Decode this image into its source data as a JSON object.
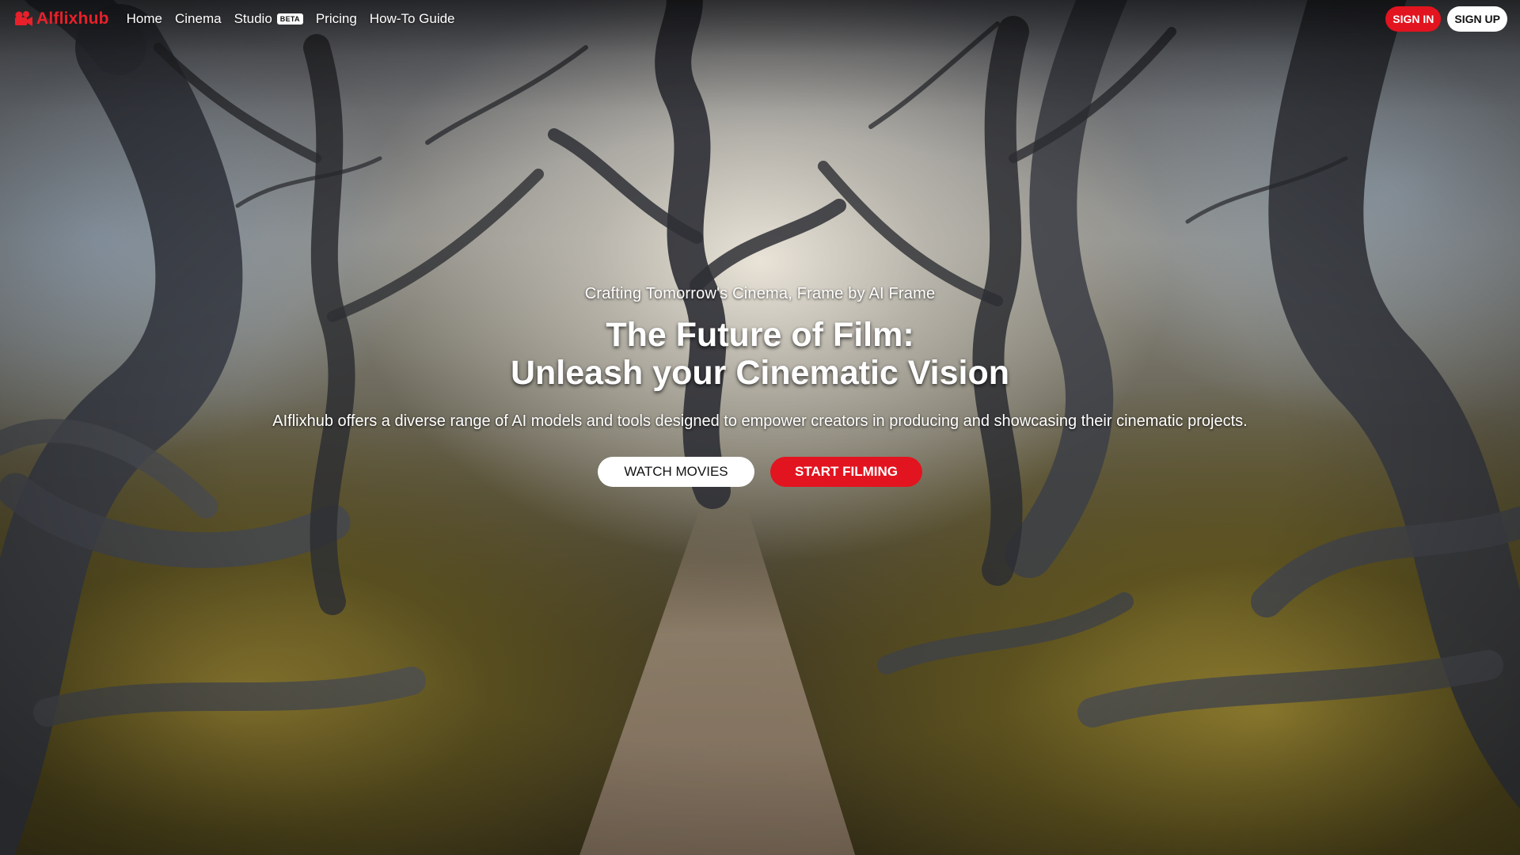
{
  "brand": {
    "name": "Alflixhub",
    "logo_icon": "film-logo-icon",
    "color": "#e8202a"
  },
  "nav": {
    "links": [
      {
        "label": "Home"
      },
      {
        "label": "Cinema"
      },
      {
        "label": "Studio",
        "badge": "BETA"
      },
      {
        "label": "Pricing"
      },
      {
        "label": "How-To Guide"
      }
    ],
    "sign_in": "SIGN IN",
    "sign_up": "SIGN UP"
  },
  "hero": {
    "tagline": "Crafting Tomorrow's Cinema, Frame by AI Frame",
    "title_line1": "The Future of Film:",
    "title_line2": "Unleash your Cinematic Vision",
    "description": "AIflixhub offers a diverse range of AI models and tools designed to empower creators in producing and showcasing their cinematic projects.",
    "watch_button": "WATCH MOVIES",
    "film_button": "START FILMING"
  },
  "colors": {
    "accent": "#e2141f",
    "button_light": "#ffffff"
  }
}
